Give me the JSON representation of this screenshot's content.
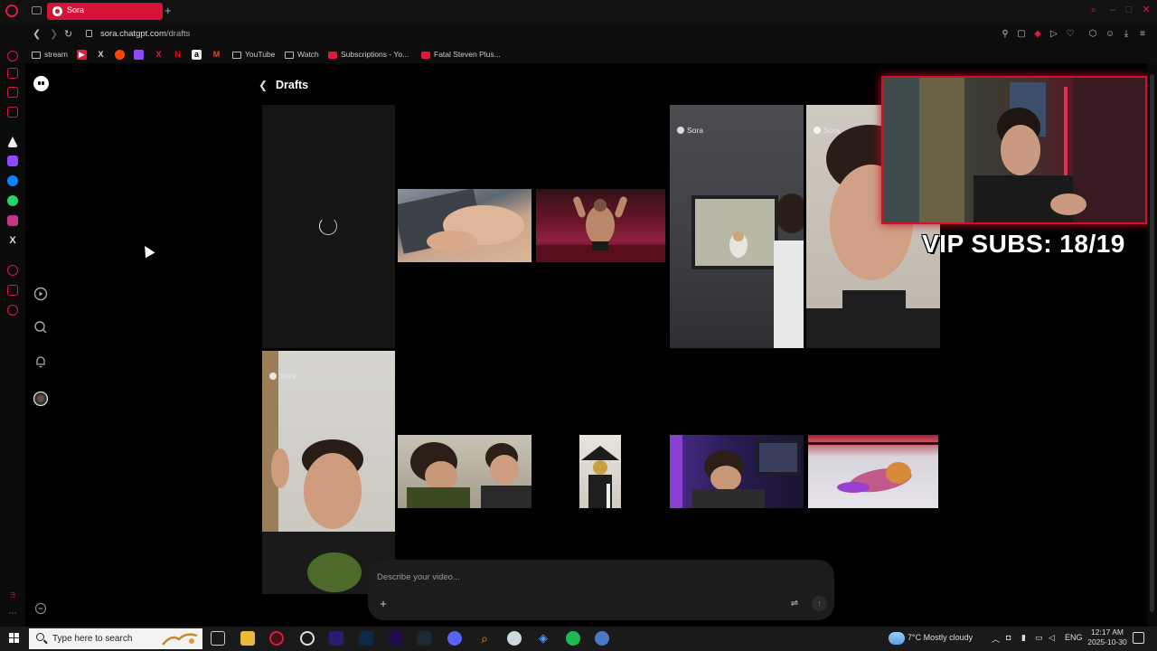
{
  "browser": {
    "tab_title": "Sora",
    "url_host": "sora.chatgpt.com",
    "url_path": "/drafts",
    "bookmarks": {
      "stream": "stream",
      "youtube": "YouTube",
      "watch": "Watch",
      "subscriptions": "Subscriptions - Yo...",
      "fatal": "Fatal Steven Plus..."
    }
  },
  "page": {
    "title": "Drafts",
    "prompt_placeholder": "Describe your video..."
  },
  "drafts": {
    "watermark": "Sora"
  },
  "overlay": {
    "vip_subs": "VIP SUBS: 18/19"
  },
  "taskbar": {
    "search_placeholder": "Type here to search",
    "weather": "7°C  Mostly cloudy",
    "lang": "ENG",
    "time": "12:17 AM",
    "date": "2025-10-30"
  },
  "colors": {
    "accent": "#d51237",
    "background": "#000000"
  }
}
